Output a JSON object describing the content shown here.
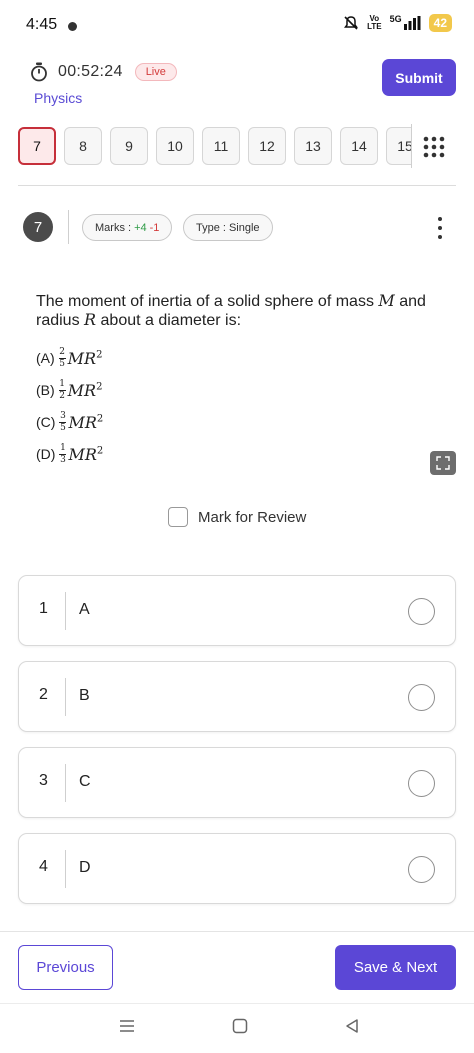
{
  "status_bar": {
    "time": "4:45",
    "volte": "Vo\nLTE",
    "network": "5G",
    "battery": "42"
  },
  "header": {
    "timer": "00:52:24",
    "live_badge": "Live",
    "subject": "Physics",
    "submit_label": "Submit"
  },
  "question_strip": {
    "items": [
      "7",
      "8",
      "9",
      "10",
      "11",
      "12",
      "13",
      "14",
      "15"
    ],
    "active": "7"
  },
  "question_header": {
    "number": "7",
    "marks_label": "Marks :",
    "marks_positive": "+4",
    "marks_negative": "-1",
    "type_label": "Type :",
    "type_value": "Single"
  },
  "question": {
    "text_part1": "The moment of inertia of a solid sphere of mass ",
    "var_mass": "M",
    "text_part2": " and radius ",
    "var_radius": "R",
    "text_part3": " about a diameter is:",
    "options": [
      {
        "label": "(A)",
        "num": "2",
        "den": "5",
        "expr": "MR",
        "exp": "2"
      },
      {
        "label": "(B)",
        "num": "1",
        "den": "2",
        "expr": "MR",
        "exp": "2"
      },
      {
        "label": "(C)",
        "num": "3",
        "den": "5",
        "expr": "MR",
        "exp": "2"
      },
      {
        "label": "(D)",
        "num": "1",
        "den": "3",
        "expr": "MR",
        "exp": "2"
      }
    ]
  },
  "review": {
    "label": "Mark for Review"
  },
  "answers": [
    {
      "num": "1",
      "text": "A"
    },
    {
      "num": "2",
      "text": "B"
    },
    {
      "num": "3",
      "text": "C"
    },
    {
      "num": "4",
      "text": "D"
    }
  ],
  "footer": {
    "previous_label": "Previous",
    "save_next_label": "Save & Next"
  },
  "colors": {
    "accent": "#5b47d6",
    "active_chip_border": "#c62f3a",
    "marks_positive": "#2e9b46",
    "marks_negative": "#d33b3b"
  },
  "icons": [
    "stopwatch-icon",
    "grid-dots-icon",
    "kebab-menu-icon",
    "expand-icon",
    "mute-icon",
    "signal-icon",
    "menu-nav-icon",
    "home-nav-icon",
    "back-nav-icon"
  ]
}
